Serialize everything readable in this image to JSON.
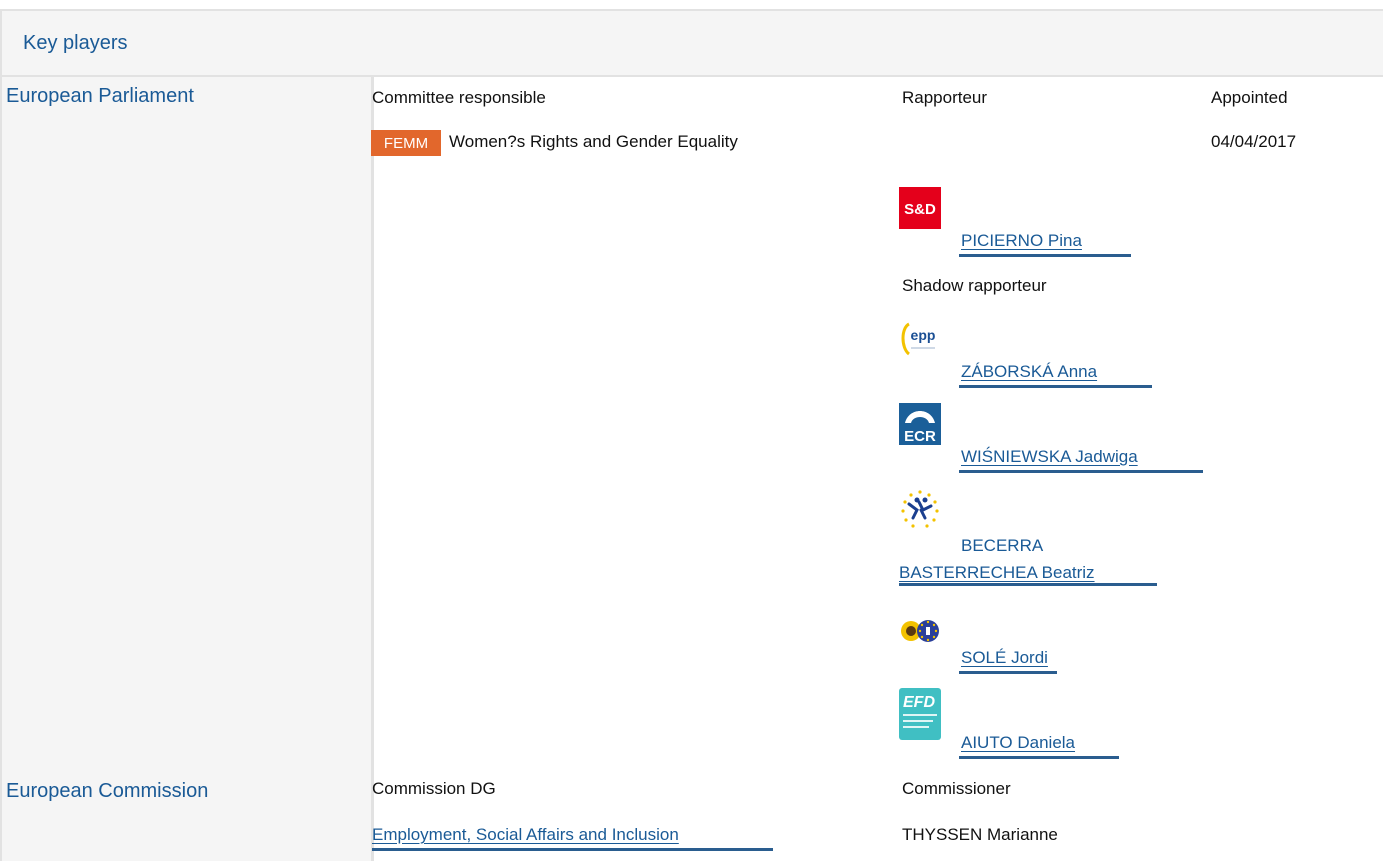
{
  "panel": {
    "title": "Key players"
  },
  "parliament": {
    "label": "European Parliament",
    "headers": {
      "committee": "Committee responsible",
      "rapporteur": "Rapporteur",
      "appointed": "Appointed"
    },
    "committee": {
      "badge": "FEMM",
      "badge_color": "#e2672c",
      "name": "Women?s Rights and Gender Equality",
      "appointed_date": "04/04/2017"
    },
    "rapporteur": {
      "name": "PICIERNO Pina",
      "group_logo_text": "S&D",
      "group_logo_icon": "sd-group-logo-icon"
    },
    "shadow_label": "Shadow rapporteur",
    "shadows": [
      {
        "name": "ZÁBORSKÁ Anna",
        "group_logo_text": "epp",
        "group_logo_icon": "epp-group-logo-icon"
      },
      {
        "name": "WIŚNIEWSKA Jadwiga",
        "group_logo_text": "ECR",
        "group_logo_icon": "ecr-group-logo-icon"
      },
      {
        "name_line1": "BECERRA",
        "name_line2": "BASTERRECHEA Beatriz",
        "group_logo_icon": "alde-group-logo-icon"
      },
      {
        "name": "SOLÉ Jordi",
        "group_logo_icon": "greens-efa-group-logo-icon"
      },
      {
        "name": "AIUTO Daniela",
        "group_logo_text": "EFD",
        "group_logo_icon": "efdd-group-logo-icon"
      }
    ]
  },
  "commission": {
    "label": "European Commission",
    "headers": {
      "dg": "Commission DG",
      "commissioner": "Commissioner"
    },
    "dg": "Employment, Social Affairs and Inclusion",
    "commissioner": "THYSSEN Marianne"
  },
  "colors": {
    "link": "#1a5a96",
    "accent_bar": "#2a5d8f",
    "panel_bg": "#f5f5f5"
  }
}
